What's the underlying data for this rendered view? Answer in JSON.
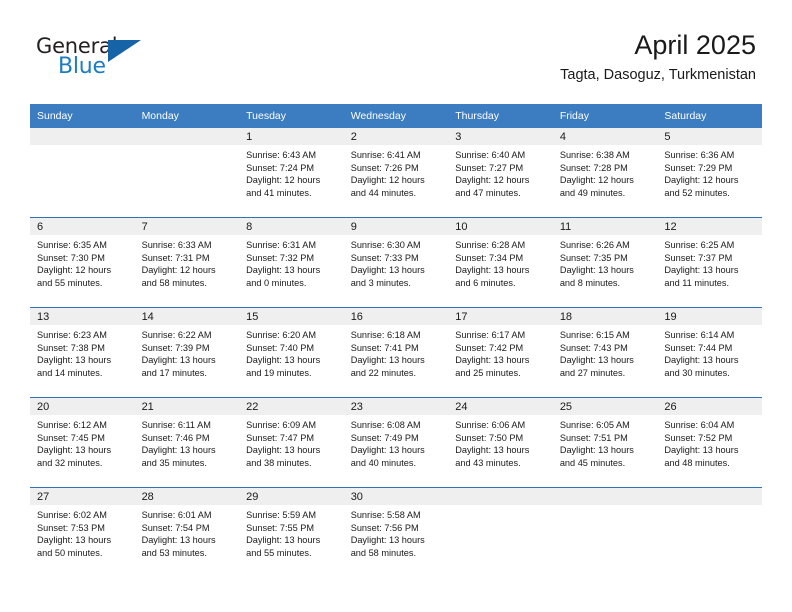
{
  "brand": {
    "word1": "General",
    "word2": "Blue",
    "logo_icon": "blue-triangle-icon",
    "accent_color": "#1763a8",
    "text_color": "#231f20"
  },
  "header": {
    "title": "April 2025",
    "subtitle": "Tagta, Dasoguz, Turkmenistan"
  },
  "theme": {
    "header_row_bg": "#3b7dc0",
    "day_strip_bg": "#efefef",
    "row_divider": "#2f72b5"
  },
  "weekday_headers": [
    "Sunday",
    "Monday",
    "Tuesday",
    "Wednesday",
    "Thursday",
    "Friday",
    "Saturday"
  ],
  "labels": {
    "sunrise": "Sunrise:",
    "sunset": "Sunset:",
    "daylight": "Daylight:"
  },
  "weeks": [
    [
      {
        "day": "",
        "empty": true
      },
      {
        "day": "",
        "empty": true
      },
      {
        "day": "1",
        "sunrise": "Sunrise: 6:43 AM",
        "sunset": "Sunset: 7:24 PM",
        "daylight_1": "Daylight: 12 hours",
        "daylight_2": "and 41 minutes."
      },
      {
        "day": "2",
        "sunrise": "Sunrise: 6:41 AM",
        "sunset": "Sunset: 7:26 PM",
        "daylight_1": "Daylight: 12 hours",
        "daylight_2": "and 44 minutes."
      },
      {
        "day": "3",
        "sunrise": "Sunrise: 6:40 AM",
        "sunset": "Sunset: 7:27 PM",
        "daylight_1": "Daylight: 12 hours",
        "daylight_2": "and 47 minutes."
      },
      {
        "day": "4",
        "sunrise": "Sunrise: 6:38 AM",
        "sunset": "Sunset: 7:28 PM",
        "daylight_1": "Daylight: 12 hours",
        "daylight_2": "and 49 minutes."
      },
      {
        "day": "5",
        "sunrise": "Sunrise: 6:36 AM",
        "sunset": "Sunset: 7:29 PM",
        "daylight_1": "Daylight: 12 hours",
        "daylight_2": "and 52 minutes."
      }
    ],
    [
      {
        "day": "6",
        "sunrise": "Sunrise: 6:35 AM",
        "sunset": "Sunset: 7:30 PM",
        "daylight_1": "Daylight: 12 hours",
        "daylight_2": "and 55 minutes."
      },
      {
        "day": "7",
        "sunrise": "Sunrise: 6:33 AM",
        "sunset": "Sunset: 7:31 PM",
        "daylight_1": "Daylight: 12 hours",
        "daylight_2": "and 58 minutes."
      },
      {
        "day": "8",
        "sunrise": "Sunrise: 6:31 AM",
        "sunset": "Sunset: 7:32 PM",
        "daylight_1": "Daylight: 13 hours",
        "daylight_2": "and 0 minutes."
      },
      {
        "day": "9",
        "sunrise": "Sunrise: 6:30 AM",
        "sunset": "Sunset: 7:33 PM",
        "daylight_1": "Daylight: 13 hours",
        "daylight_2": "and 3 minutes."
      },
      {
        "day": "10",
        "sunrise": "Sunrise: 6:28 AM",
        "sunset": "Sunset: 7:34 PM",
        "daylight_1": "Daylight: 13 hours",
        "daylight_2": "and 6 minutes."
      },
      {
        "day": "11",
        "sunrise": "Sunrise: 6:26 AM",
        "sunset": "Sunset: 7:35 PM",
        "daylight_1": "Daylight: 13 hours",
        "daylight_2": "and 8 minutes."
      },
      {
        "day": "12",
        "sunrise": "Sunrise: 6:25 AM",
        "sunset": "Sunset: 7:37 PM",
        "daylight_1": "Daylight: 13 hours",
        "daylight_2": "and 11 minutes."
      }
    ],
    [
      {
        "day": "13",
        "sunrise": "Sunrise: 6:23 AM",
        "sunset": "Sunset: 7:38 PM",
        "daylight_1": "Daylight: 13 hours",
        "daylight_2": "and 14 minutes."
      },
      {
        "day": "14",
        "sunrise": "Sunrise: 6:22 AM",
        "sunset": "Sunset: 7:39 PM",
        "daylight_1": "Daylight: 13 hours",
        "daylight_2": "and 17 minutes."
      },
      {
        "day": "15",
        "sunrise": "Sunrise: 6:20 AM",
        "sunset": "Sunset: 7:40 PM",
        "daylight_1": "Daylight: 13 hours",
        "daylight_2": "and 19 minutes."
      },
      {
        "day": "16",
        "sunrise": "Sunrise: 6:18 AM",
        "sunset": "Sunset: 7:41 PM",
        "daylight_1": "Daylight: 13 hours",
        "daylight_2": "and 22 minutes."
      },
      {
        "day": "17",
        "sunrise": "Sunrise: 6:17 AM",
        "sunset": "Sunset: 7:42 PM",
        "daylight_1": "Daylight: 13 hours",
        "daylight_2": "and 25 minutes."
      },
      {
        "day": "18",
        "sunrise": "Sunrise: 6:15 AM",
        "sunset": "Sunset: 7:43 PM",
        "daylight_1": "Daylight: 13 hours",
        "daylight_2": "and 27 minutes."
      },
      {
        "day": "19",
        "sunrise": "Sunrise: 6:14 AM",
        "sunset": "Sunset: 7:44 PM",
        "daylight_1": "Daylight: 13 hours",
        "daylight_2": "and 30 minutes."
      }
    ],
    [
      {
        "day": "20",
        "sunrise": "Sunrise: 6:12 AM",
        "sunset": "Sunset: 7:45 PM",
        "daylight_1": "Daylight: 13 hours",
        "daylight_2": "and 32 minutes."
      },
      {
        "day": "21",
        "sunrise": "Sunrise: 6:11 AM",
        "sunset": "Sunset: 7:46 PM",
        "daylight_1": "Daylight: 13 hours",
        "daylight_2": "and 35 minutes."
      },
      {
        "day": "22",
        "sunrise": "Sunrise: 6:09 AM",
        "sunset": "Sunset: 7:47 PM",
        "daylight_1": "Daylight: 13 hours",
        "daylight_2": "and 38 minutes."
      },
      {
        "day": "23",
        "sunrise": "Sunrise: 6:08 AM",
        "sunset": "Sunset: 7:49 PM",
        "daylight_1": "Daylight: 13 hours",
        "daylight_2": "and 40 minutes."
      },
      {
        "day": "24",
        "sunrise": "Sunrise: 6:06 AM",
        "sunset": "Sunset: 7:50 PM",
        "daylight_1": "Daylight: 13 hours",
        "daylight_2": "and 43 minutes."
      },
      {
        "day": "25",
        "sunrise": "Sunrise: 6:05 AM",
        "sunset": "Sunset: 7:51 PM",
        "daylight_1": "Daylight: 13 hours",
        "daylight_2": "and 45 minutes."
      },
      {
        "day": "26",
        "sunrise": "Sunrise: 6:04 AM",
        "sunset": "Sunset: 7:52 PM",
        "daylight_1": "Daylight: 13 hours",
        "daylight_2": "and 48 minutes."
      }
    ],
    [
      {
        "day": "27",
        "sunrise": "Sunrise: 6:02 AM",
        "sunset": "Sunset: 7:53 PM",
        "daylight_1": "Daylight: 13 hours",
        "daylight_2": "and 50 minutes."
      },
      {
        "day": "28",
        "sunrise": "Sunrise: 6:01 AM",
        "sunset": "Sunset: 7:54 PM",
        "daylight_1": "Daylight: 13 hours",
        "daylight_2": "and 53 minutes."
      },
      {
        "day": "29",
        "sunrise": "Sunrise: 5:59 AM",
        "sunset": "Sunset: 7:55 PM",
        "daylight_1": "Daylight: 13 hours",
        "daylight_2": "and 55 minutes."
      },
      {
        "day": "30",
        "sunrise": "Sunrise: 5:58 AM",
        "sunset": "Sunset: 7:56 PM",
        "daylight_1": "Daylight: 13 hours",
        "daylight_2": "and 58 minutes."
      },
      {
        "day": "",
        "empty": true
      },
      {
        "day": "",
        "empty": true
      },
      {
        "day": "",
        "empty": true
      }
    ]
  ]
}
